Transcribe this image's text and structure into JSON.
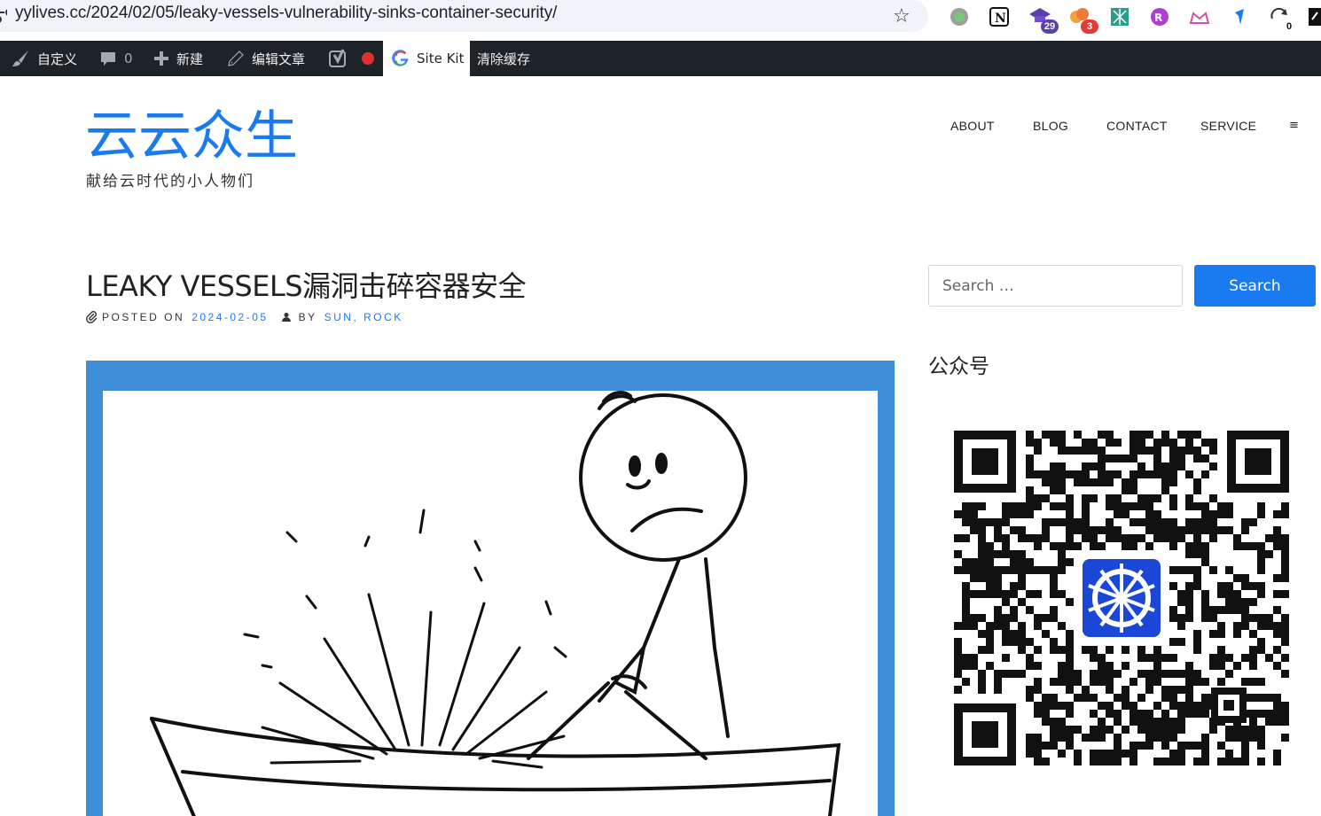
{
  "browser": {
    "url": "yylives.cc/2024/02/05/leaky-vessels-vulnerability-sinks-container-security/",
    "extensions": [
      {
        "name": "color-circle-extension-icon",
        "badge": ""
      },
      {
        "name": "notion-extension-icon",
        "badge": ""
      },
      {
        "name": "graduation-cap-extension-icon",
        "badge": "29"
      },
      {
        "name": "cloud-extension-icon",
        "badge": "3"
      },
      {
        "name": "grid-extension-icon",
        "badge": ""
      },
      {
        "name": "purple-logo-extension-icon",
        "badge": ""
      },
      {
        "name": "crown-extension-icon",
        "badge": ""
      },
      {
        "name": "blue-arrow-extension-icon",
        "badge": ""
      },
      {
        "name": "sync-extension-icon",
        "badge": "0"
      }
    ]
  },
  "admin_bar": {
    "customize_label": "自定义",
    "comments_count": "0",
    "new_label": "新建",
    "edit_post_label": "编辑文章",
    "sitekit_label": "Site Kit",
    "clear_cache_label": "清除缓存"
  },
  "site": {
    "title": "云云众生",
    "tagline": "献给云时代的小人物们",
    "nav": [
      "ABOUT",
      "BLOG",
      "CONTACT",
      "SERVICE"
    ],
    "menu_toggle": "≡"
  },
  "post": {
    "title": "LEAKY VESSELS漏洞击碎容器安全",
    "posted_on_label": "POSTED ON",
    "date": "2024-02-05",
    "by_label": "BY",
    "author": "SUN, ROCK"
  },
  "sidebar": {
    "search_placeholder": "Search …",
    "search_button": "Search",
    "widget_title": "公众号"
  },
  "colors": {
    "accent": "#1a7bf0",
    "admin_bar": "#1d2327",
    "image_border": "#3f8fd8"
  }
}
